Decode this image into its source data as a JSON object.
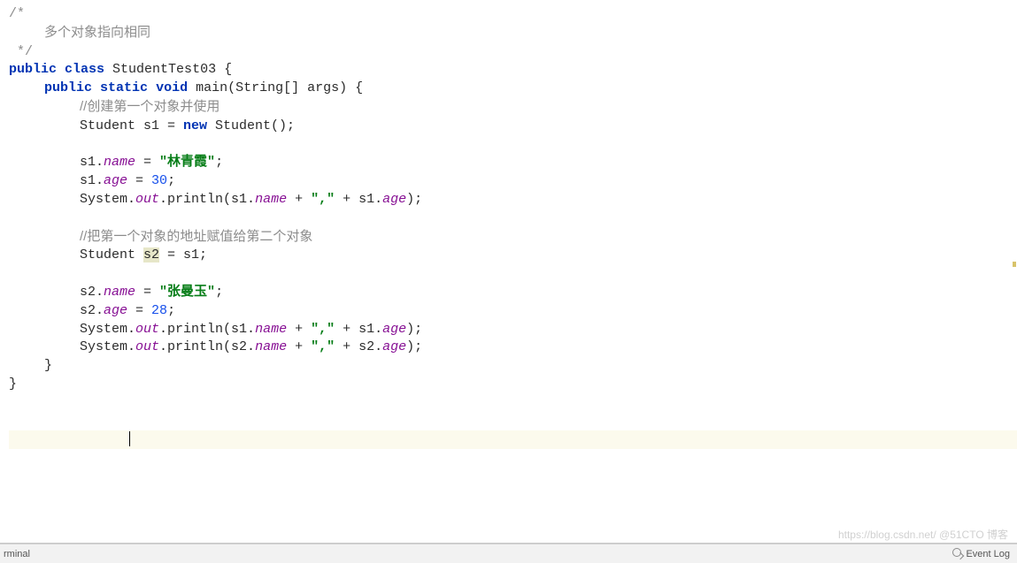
{
  "code": {
    "line1": "/*",
    "line2": "多个对象指向相同",
    "line3": " */",
    "kw_public": "public",
    "kw_class": "class",
    "kw_static": "static",
    "kw_void": "void",
    "kw_new": "new",
    "class_name": " StudentTest03 {",
    "main_sig": " main(String[] args) {",
    "comment_create": "//创建第一个对象并使用",
    "line_s1_decl": "Student s1 = ",
    "line_s1_ctor": " Student();",
    "s1_name_lhs": "s1.",
    "field_name": "name",
    "assign_eq": " = ",
    "str_linqingxia": "\"林青霞\"",
    "semicolon": ";",
    "s1_age_lhs": "s1.",
    "field_age": "age",
    "num_30": "30",
    "sys": "System.",
    "field_out": "out",
    "println_open": ".println(s1.",
    "plus_comma": " + ",
    "str_comma": "\",\"",
    "s1_age_close": " + s1.",
    "close_paren": ");",
    "comment_assign": "//把第一个对象的地址赋值给第二个对象",
    "line_s2_decl_a": "Student ",
    "var_s2": "s2",
    "line_s2_decl_b": " = s1;",
    "s2_prefix": "s2.",
    "str_zhangmanyu": "\"张曼玉\"",
    "num_28": "28",
    "println_open_s2": ".println(s2.",
    "s2_age_close": " + s2.",
    "brace_close": "}"
  },
  "bottom": {
    "terminal": "rminal",
    "event_log": "Event Log"
  },
  "watermark": "https://blog.csdn.net/ @51CTO 博客"
}
